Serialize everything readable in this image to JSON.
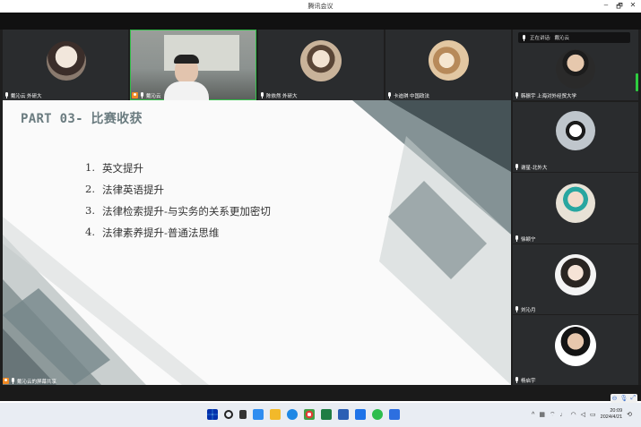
{
  "window": {
    "title": "腾讯会议",
    "minimize": "–",
    "maximize": "🗗",
    "close": "✕"
  },
  "participants_top": [
    {
      "name": "戴沁云 外研大"
    },
    {
      "name": "戴沁云",
      "is_host": true,
      "speaking": true
    },
    {
      "name": "陈依然 外研大"
    },
    {
      "name": "卡迪琪 中国政法"
    },
    {
      "name": "韩振宇 上海对外经贸大学"
    }
  ],
  "participants_right": [
    {
      "name": "谢星-北外大"
    },
    {
      "name": "徐颖宁"
    },
    {
      "name": "刘沁月"
    },
    {
      "name": "杨启宇"
    }
  ],
  "speaking_indicator": {
    "label": "正在讲话:",
    "name": "戴沁云"
  },
  "slide": {
    "title": "PART 03- 比赛收获",
    "items": [
      {
        "num": "1.",
        "text": "英文提升"
      },
      {
        "num": "2.",
        "text": "法律英语提升"
      },
      {
        "num": "3.",
        "text": "法律检索提升-与实务的关系更加密切"
      },
      {
        "num": "4.",
        "text": "法律素养提升-普通法思维"
      }
    ]
  },
  "share_label": "戴沁云的屏幕共享",
  "taskbar": {
    "time": "20:09",
    "date": "2024/4/21",
    "tray_chevron": "^"
  },
  "colors": {
    "active_speaker": "#33c04a",
    "host_badge": "#f08a24",
    "slide_title": "#6b7c80"
  }
}
